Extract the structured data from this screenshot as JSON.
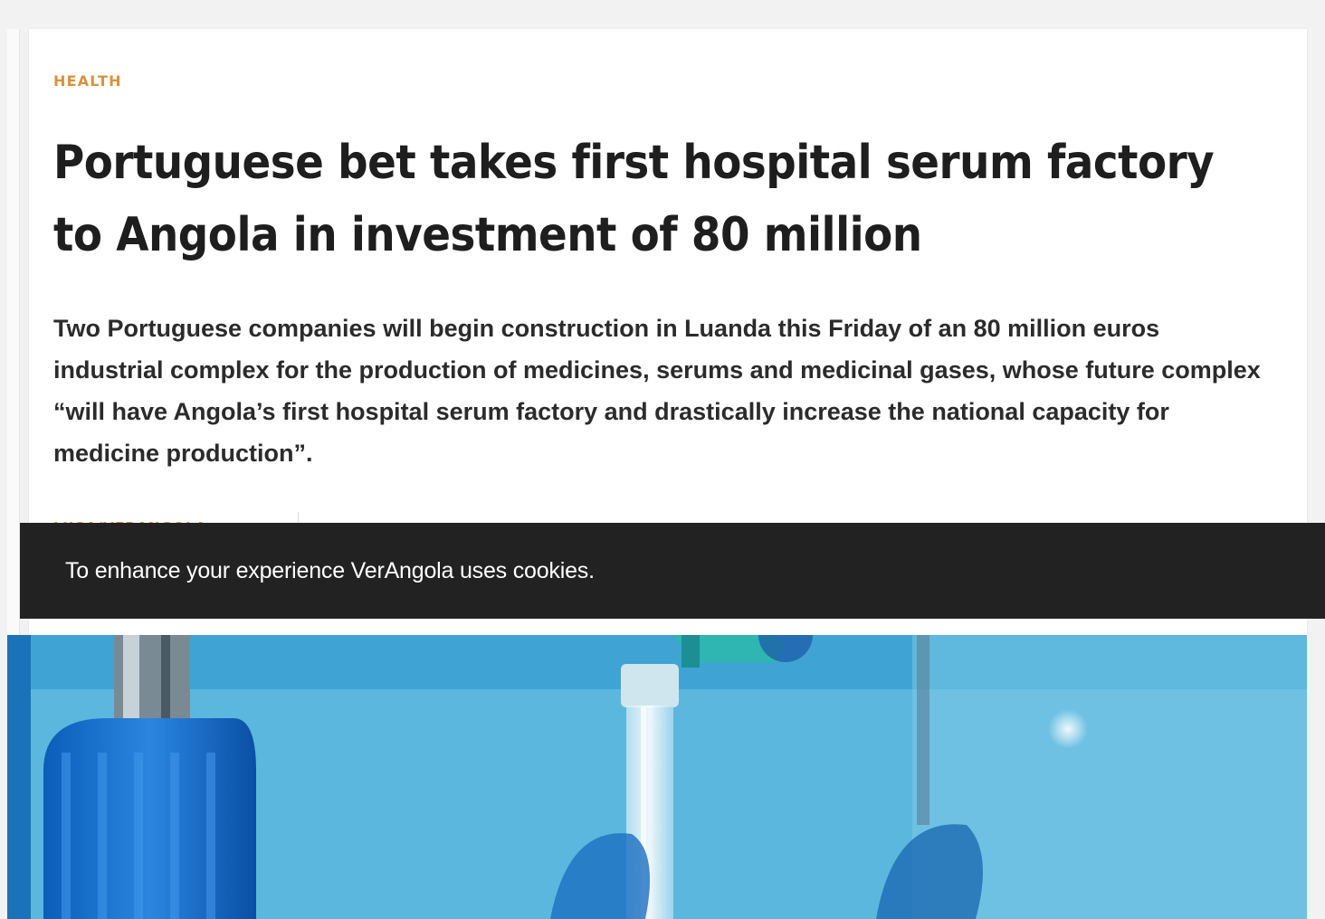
{
  "article": {
    "category": "HEALTH",
    "headline": "Portuguese bet takes first hospital serum factory to Angola in investment of 80 million",
    "lead": "Two Portuguese companies will begin construction in Luanda this Friday of an 80 million euros industrial complex for the production of medicines, serums and medicinal gases, whose future complex “will have Angola’s first hospital serum factory and drastically increase the national capacity for medicine production”.",
    "author": "LUSA/VERANGOLA"
  },
  "cookie_banner": {
    "text": "To enhance your experience VerAngola uses cookies."
  },
  "hero_image": {
    "subject": "hospital IV drip tube and bottle caps on blue background"
  },
  "colors": {
    "accent": "#d9913f",
    "headline": "#1e1e1e",
    "cookie_bar": "#222222",
    "hero_blue": "#66bde0"
  }
}
